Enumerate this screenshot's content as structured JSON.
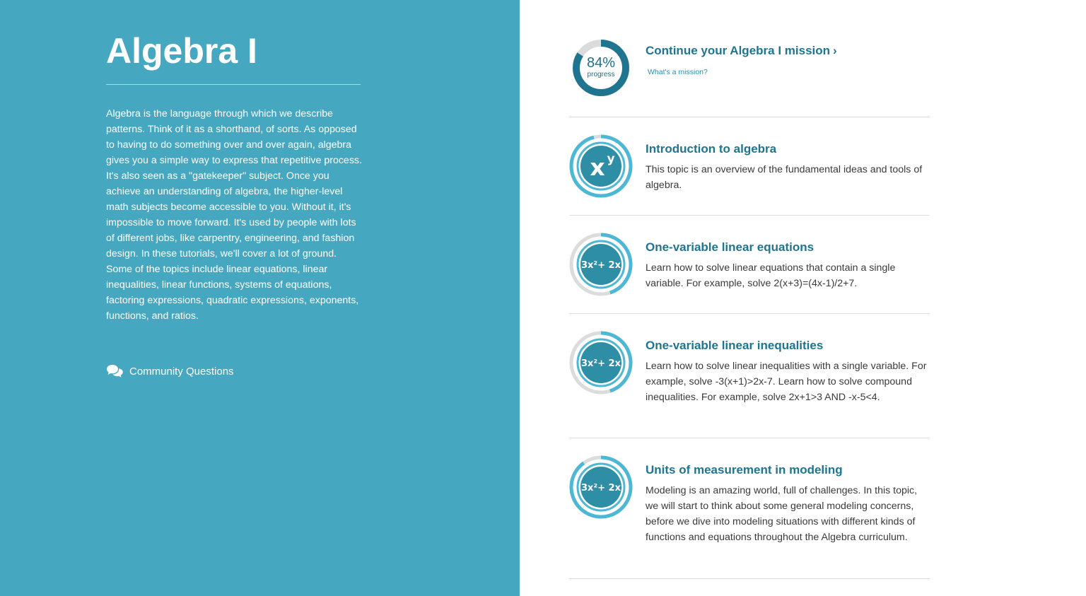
{
  "colors": {
    "left_panel_bg": "#46a8c0",
    "accent_dark": "#1f7590",
    "ring_light": "#4db8d6",
    "ring_track": "#dcdcdc",
    "icon_fill": "#2e8ea6"
  },
  "subject": {
    "title": "Algebra I",
    "description": "Algebra is the language through which we describe patterns. Think of it as a shorthand, of sorts. As opposed to having to do something over and over again, algebra gives you a simple way to express that repetitive process. It's also seen as a \"gatekeeper\" subject. Once you achieve an understanding of algebra, the higher-level math subjects become accessible to you. Without it, it's impossible to move forward. It's used by people with lots of different jobs, like carpentry, engineering, and fashion design. In these tutorials, we'll cover a lot of ground. Some of the topics include linear equations, linear inequalities, linear functions, systems of equations, factoring expressions, quadratic expressions, exponents, functions, and ratios.",
    "community_label": "Community Questions",
    "community_icon": "speech-bubbles-icon"
  },
  "mission": {
    "progress_text": "84%",
    "progress_value": 0.84,
    "progress_label": "progress",
    "link_label": "Continue your Algebra I mission",
    "link_icon": "chevron-right-icon",
    "help_label": "What's a mission?"
  },
  "topics": [
    {
      "title": "Introduction to algebra",
      "description": "This topic is an overview of the fundamental ideas and tools of algebra.",
      "icon": "x-to-the-y-icon",
      "progress": 0.96
    },
    {
      "title": "One-variable linear equations",
      "description": "Learn how to solve linear equations that contain a single variable. For example, solve 2(x+3)=(4x-1)/2+7.",
      "icon": "polynomial-icon",
      "progress": 0.45
    },
    {
      "title": "One-variable linear inequalities",
      "description": "Learn how to solve linear inequalities with a single variable. For example, solve -3(x+1)>2x-7. Learn how to solve compound inequalities. For example, solve 2x+1>3 AND -x-5<4.",
      "icon": "polynomial-icon",
      "progress": 0.45
    },
    {
      "title": "Units of measurement in modeling",
      "description": "Modeling is an amazing world, full of challenges. In this topic, we will start to think about some general modeling concerns, before we dive into modeling situations with different kinds of functions and equations throughout the Algebra curriculum.",
      "icon": "polynomial-icon",
      "progress": 0.9
    }
  ]
}
